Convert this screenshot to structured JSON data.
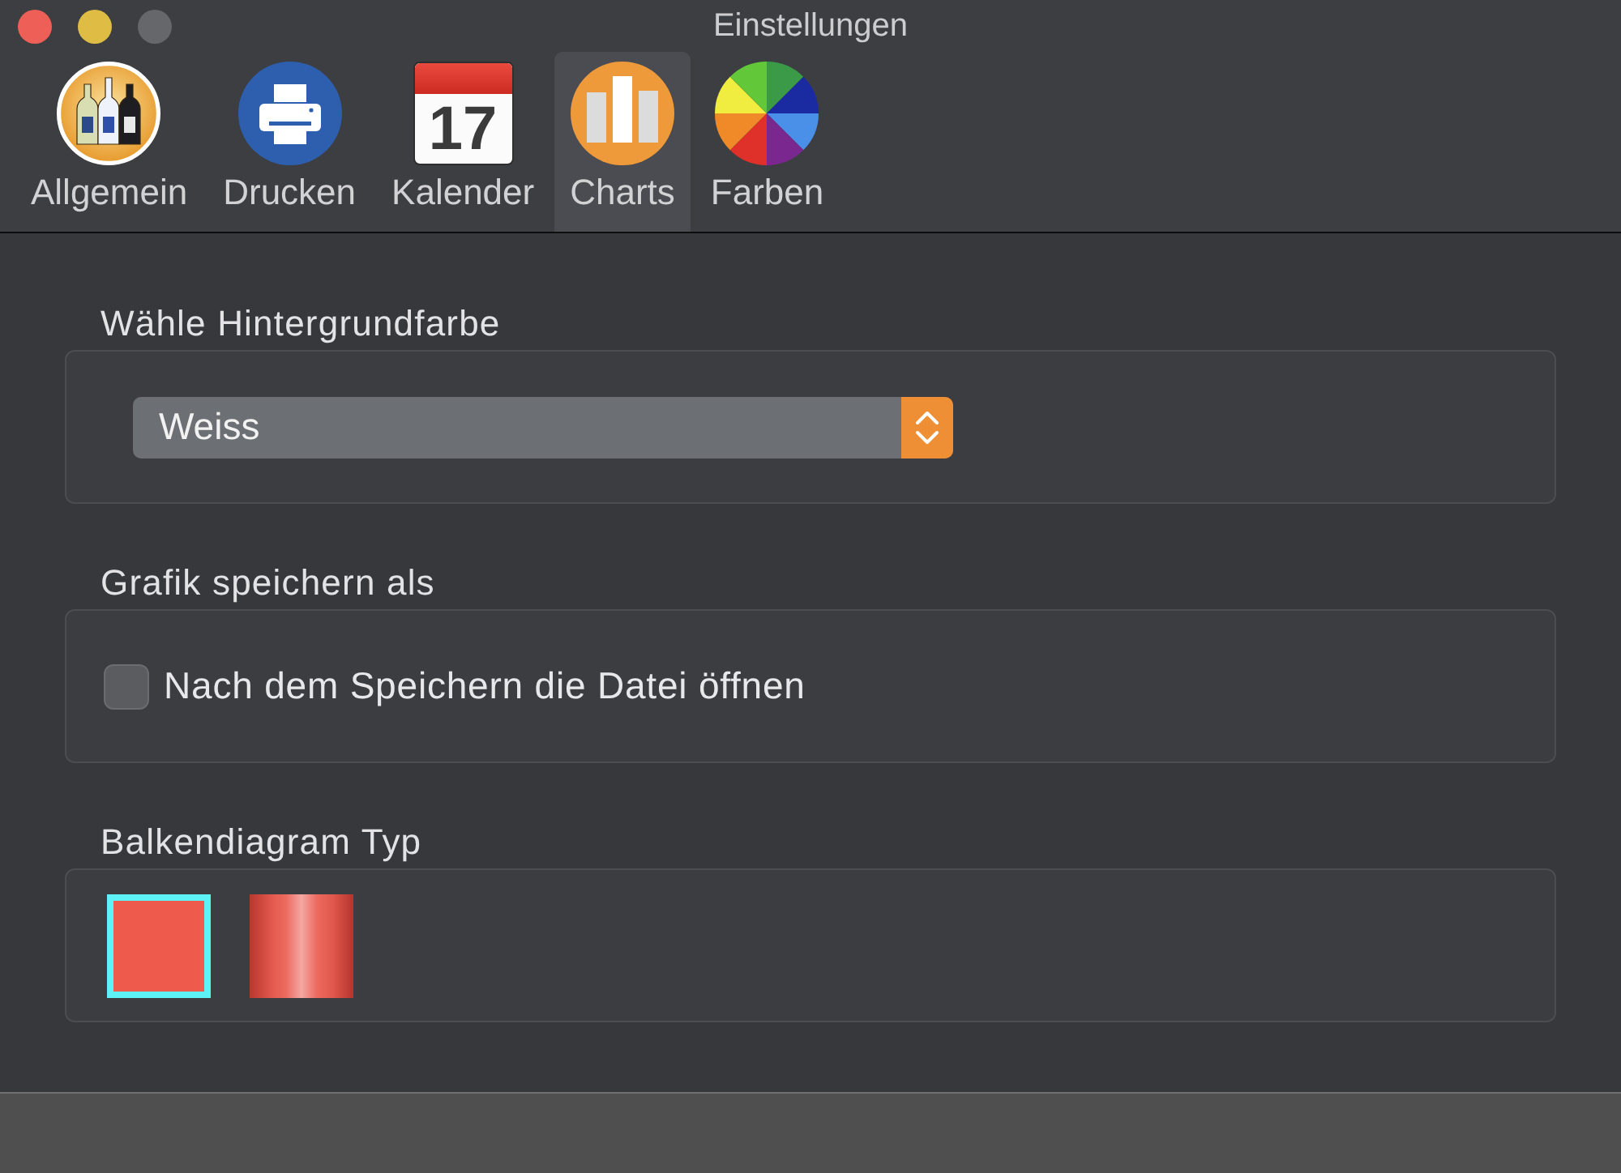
{
  "window": {
    "title": "Einstellungen"
  },
  "toolbar": [
    {
      "kind": "general",
      "label": "Allgemein",
      "selected": false
    },
    {
      "kind": "print",
      "label": "Drucken",
      "selected": false
    },
    {
      "kind": "calendar",
      "label": "Kalender",
      "day": "17",
      "selected": false
    },
    {
      "kind": "charts",
      "label": "Charts",
      "selected": true
    },
    {
      "kind": "colors",
      "label": "Farben",
      "selected": false
    }
  ],
  "sections": [
    {
      "kind": "popup",
      "title": "Wähle Hintergrundfarbe",
      "value": "Weiss"
    },
    {
      "kind": "checkbox",
      "title": "Grafik speichern als",
      "label": "Nach dem Speichern die Datei öffnen",
      "checked": false
    },
    {
      "kind": "swatches",
      "title": "Balkendiagram Typ",
      "options": [
        {
          "kind": "flat",
          "selected": true
        },
        {
          "kind": "gradient",
          "selected": false
        }
      ]
    }
  ]
}
